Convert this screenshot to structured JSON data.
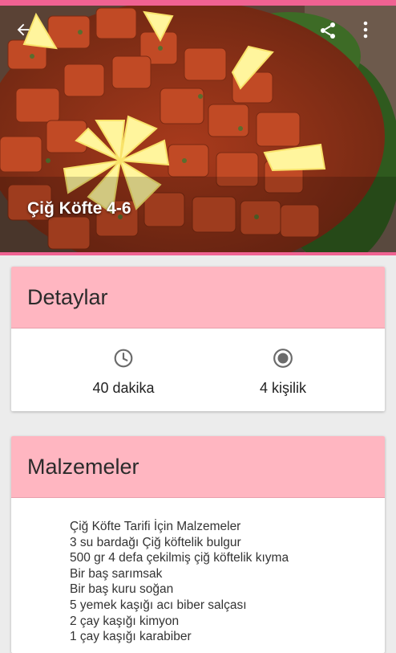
{
  "header": {
    "title": "Çiğ Köfte 4-6",
    "icons": {
      "back": "arrow-back-icon",
      "share": "share-icon",
      "more": "more-vert-icon"
    }
  },
  "details": {
    "heading": "Detaylar",
    "time_value": "40 dakika",
    "time_icon": "clock-icon",
    "servings_value": "4 kişilik",
    "servings_icon": "radio-dot-icon"
  },
  "ingredients": {
    "heading": "Malzemeler",
    "lines": [
      "Çiğ Köfte Tarifi İçin Malzemeler",
      "3 su bardağı Çiğ köftelik bulgur",
      "500 gr 4 defa çekilmiş çiğ köftelik kıyma",
      "Bir baş sarımsak",
      "Bir baş kuru soğan",
      "5 yemek kaşığı acı biber salçası",
      "2 çay kaşığı kimyon",
      "1 çay kaşığı karabiber"
    ]
  },
  "colors": {
    "accent": "#f06292",
    "card_header": "#ffb6c1",
    "background": "#ececec"
  }
}
